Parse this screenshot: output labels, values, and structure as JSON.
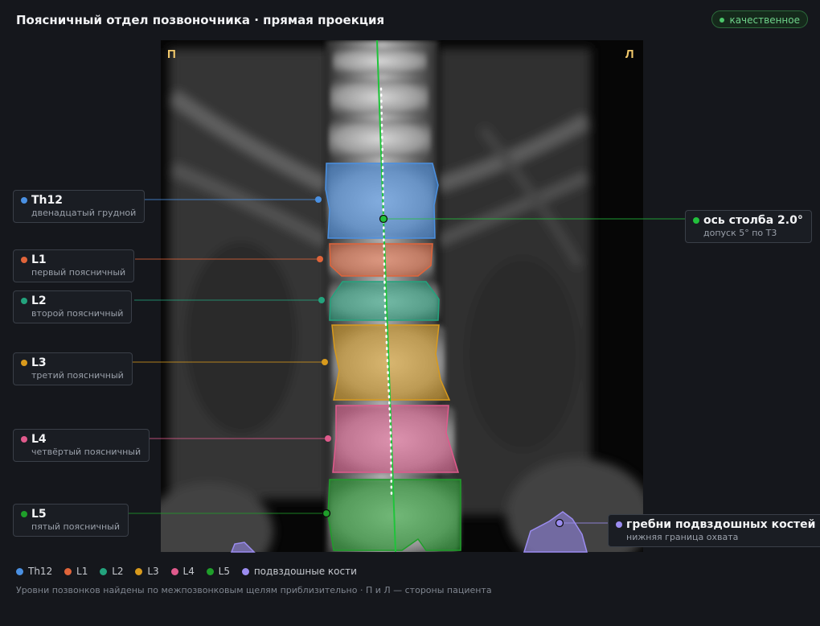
{
  "header": {
    "title": "Поясничный отдел позвоночника · прямая проекция",
    "badge": "качественное"
  },
  "image": {
    "side_right_marker": "П",
    "side_left_marker": "Л"
  },
  "callouts": {
    "th12": {
      "title": "Th12",
      "subtitle": "двенадцатый грудной",
      "color": "#4a90e2"
    },
    "l1": {
      "title": "L1",
      "subtitle": "первый поясничный",
      "color": "#e0643a"
    },
    "l2": {
      "title": "L2",
      "subtitle": "второй поясничный",
      "color": "#23a37d"
    },
    "l3": {
      "title": "L3",
      "subtitle": "третий поясничный",
      "color": "#d89a1c"
    },
    "l4": {
      "title": "L4",
      "subtitle": "четвёртый поясничный",
      "color": "#e05a8c"
    },
    "l5": {
      "title": "L5",
      "subtitle": "пятый поясничный",
      "color": "#1f9e2a"
    },
    "axis": {
      "title": "ось столба 2.0°",
      "subtitle": "допуск 5° по Т3",
      "color": "#22c03c"
    },
    "iliac": {
      "title": "гребни подвздошных костей",
      "subtitle": "нижняя граница охвата",
      "color": "#9b8cf0"
    }
  },
  "legend": [
    {
      "label": "Th12",
      "color": "#4a90e2"
    },
    {
      "label": "L1",
      "color": "#e0643a"
    },
    {
      "label": "L2",
      "color": "#23a37d"
    },
    {
      "label": "L3",
      "color": "#d89a1c"
    },
    {
      "label": "L4",
      "color": "#e05a8c"
    },
    {
      "label": "L5",
      "color": "#1f9e2a"
    },
    {
      "label": "подвздошные кости",
      "color": "#9b8cf0"
    }
  ],
  "footnote": "Уровни позвонков найдены по межпозвонковым щелям приблизительно · П и Л — стороны пациента"
}
